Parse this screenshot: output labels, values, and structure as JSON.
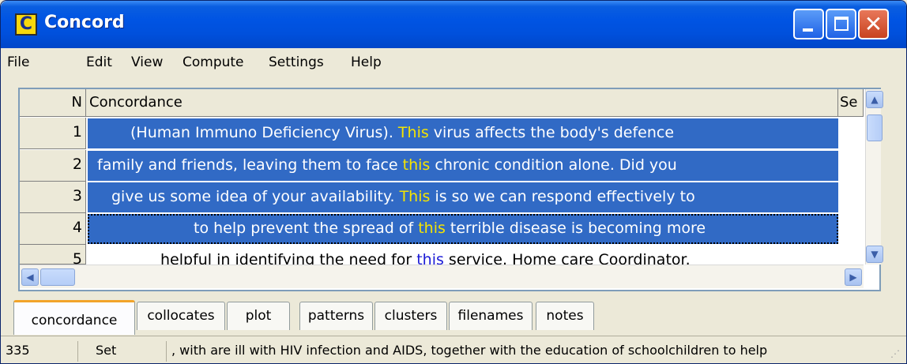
{
  "window": {
    "title": "Concord",
    "icon_letter": "C",
    "controls": [
      "minimize-icon",
      "maximize-icon",
      "close-icon"
    ],
    "close_glyph": "✕"
  },
  "menu": {
    "file": "File",
    "edit": "Edit",
    "view": "View",
    "compute": "Compute",
    "settings": "Settings",
    "help": "Help"
  },
  "table": {
    "headers": {
      "n": "N",
      "concordance": "Concordance",
      "set": "Se"
    },
    "rows": [
      {
        "n": "1",
        "left": "(Human Immuno Deficiency Virus). ",
        "keyword": "This",
        "right": " virus affects the body's defence",
        "selected": true
      },
      {
        "n": "2",
        "left": "family and friends, leaving them to face ",
        "keyword": "this",
        "right": " chronic condition alone. Did you",
        "selected": true
      },
      {
        "n": "3",
        "left": "give us some idea of your availability. ",
        "keyword": "This",
        "right": " is so we can respond effectively to",
        "selected": true
      },
      {
        "n": "4",
        "left": "to help prevent the spread of ",
        "keyword": "this",
        "right": " terrible disease is becoming more",
        "selected": true
      },
      {
        "n": "5",
        "left": "helpful in identifying the need for ",
        "keyword": "this",
        "right": " service. Home care Coordinator.",
        "selected": false
      }
    ]
  },
  "tabs": [
    "concordance",
    "collocates",
    "plot",
    "patterns",
    "clusters",
    "filenames",
    "notes"
  ],
  "active_tab": "concordance",
  "status": {
    "count": "335",
    "set": "Set",
    "context": ", with are ill with HIV infection and AIDS, together with the education of schoolchildren to help"
  },
  "colors": {
    "title_bar": "#0054e3",
    "selection": "#316ac5",
    "keyword_selected": "#f5e400",
    "keyword": "#1b1bd6"
  }
}
